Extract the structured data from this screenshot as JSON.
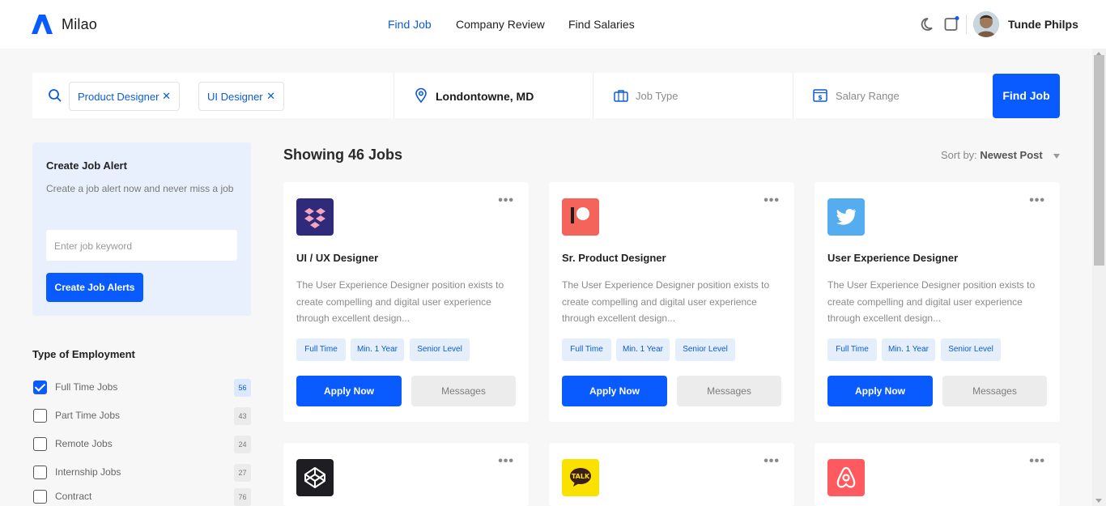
{
  "header": {
    "brand": "Milao",
    "nav": [
      "Find Job",
      "Company Review",
      "Find Salaries"
    ],
    "user_name": "Tunde Philps",
    "accent": "#0a5bff"
  },
  "search": {
    "chips": [
      "Product Designer",
      "UI Designer"
    ],
    "location": "Londontowne, MD",
    "job_type_placeholder": "Job Type",
    "salary_placeholder": "Salary Range",
    "button": "Find Job"
  },
  "alert": {
    "title": "Create Job Alert",
    "description": "Create a job alert now and never miss a job",
    "input_placeholder": "Enter job keyword",
    "button": "Create Job Alerts"
  },
  "filters": {
    "title": "Type of Employment",
    "items": [
      {
        "label": "Full Time Jobs",
        "count": "56",
        "checked": true
      },
      {
        "label": "Part Time Jobs",
        "count": "43",
        "checked": false
      },
      {
        "label": "Remote Jobs",
        "count": "24",
        "checked": false
      },
      {
        "label": "Internship Jobs",
        "count": "27",
        "checked": false
      },
      {
        "label": "Contract",
        "count": "76",
        "checked": false
      }
    ]
  },
  "results": {
    "showing": "Showing 46 Jobs",
    "sort_label": "Sort by:",
    "sort_value": "Newest Post"
  },
  "jobs": [
    {
      "logo": "dropbox-icon",
      "title": "UI / UX Designer",
      "description": "The User Experience Designer position exists to create compelling and digital user experience through excellent design...",
      "tags": [
        "Full Time",
        "Min. 1 Year",
        "Senior Level"
      ],
      "apply": "Apply Now",
      "messages": "Messages"
    },
    {
      "logo": "patreon-icon",
      "title": "Sr. Product Designer",
      "description": "The User Experience Designer position exists to create compelling and digital user experience through excellent design...",
      "tags": [
        "Full Time",
        "Min. 1 Year",
        "Senior Level"
      ],
      "apply": "Apply Now",
      "messages": "Messages"
    },
    {
      "logo": "twitter-icon",
      "title": "User Experience Designer",
      "description": "The User Experience Designer position exists to create compelling and digital user experience through excellent design...",
      "tags": [
        "Full Time",
        "Min. 1 Year",
        "Senior Level"
      ],
      "apply": "Apply Now",
      "messages": "Messages"
    },
    {
      "logo": "codepen-icon"
    },
    {
      "logo": "kakaotalk-icon",
      "logo_text": "TALK"
    },
    {
      "logo": "airbnb-icon"
    }
  ]
}
